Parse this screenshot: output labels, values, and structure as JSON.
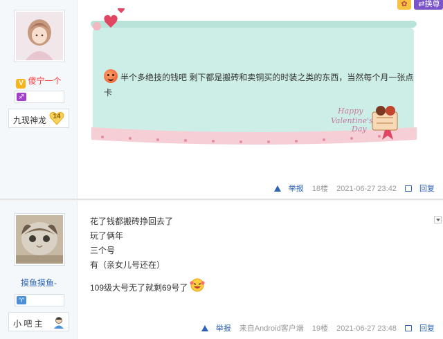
{
  "post1": {
    "username": "傻宁一个",
    "level_title": "九现神龙",
    "level_number": "14",
    "content": "半个多绝技的钱吧 剩下都是搬砖和卖铜买的时装之类的东西，当然每个月一张点卡",
    "floor": "18楼",
    "timestamp": "2021-06-27 23:42",
    "report_label": "举报",
    "reply_label": "回复",
    "header_swap_label": "换尊"
  },
  "post2": {
    "username": "摸鱼摸鱼-",
    "level_title": "小 吧 主",
    "lines": [
      "花了钱都搬砖挣回去了",
      "玩了俩年",
      "三个号",
      "有（亲女儿号还在）",
      "109级大号无了就剩69号了"
    ],
    "source": "来自Android客户端",
    "floor": "19楼",
    "timestamp": "2021-06-27 23:48",
    "report_label": "举报",
    "reply_label": "回复"
  },
  "colors": {
    "link": "#2d64b3",
    "vip_name": "#ff3d3d",
    "letter_bg": "#cdeee6"
  },
  "icons": [
    "vip-icon",
    "zodiac-badge",
    "heart-level-badge",
    "person-icon",
    "report-icon",
    "reply-icon",
    "smiley-emoji",
    "dropdown-icon",
    "gift-icon",
    "swap-icon"
  ]
}
